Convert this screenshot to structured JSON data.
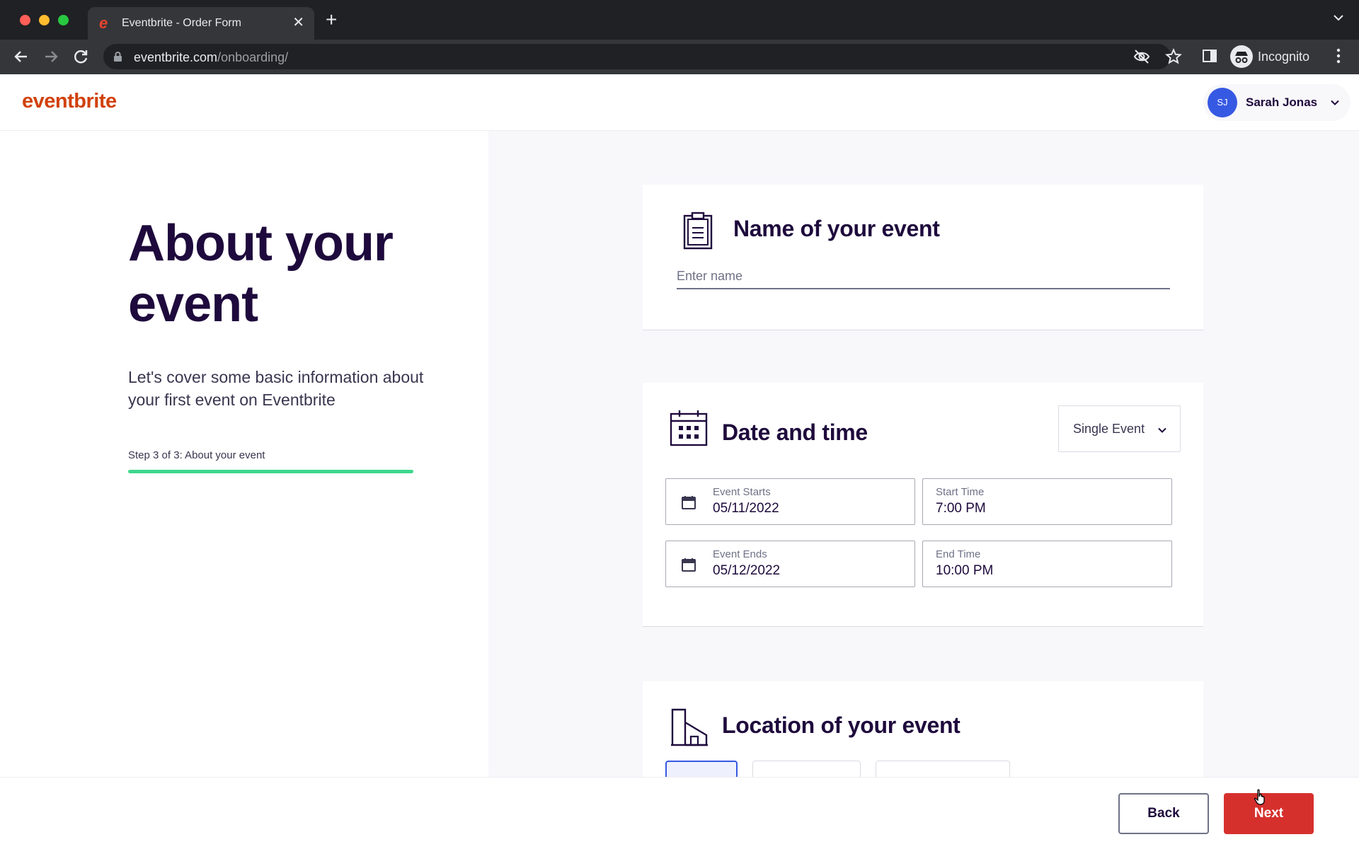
{
  "browser": {
    "tab_title": "Eventbrite - Order Form",
    "tab_favicon": "e",
    "url_host": "eventbrite.com",
    "url_path": "/onboarding/",
    "profile_label": "Incognito"
  },
  "header": {
    "logo": "eventbrite",
    "user_initials": "SJ",
    "user_name": "Sarah Jonas"
  },
  "intro": {
    "title": "About your event",
    "description": "Let's cover some basic information about your first event on Eventbrite",
    "step_label": "Step 3 of 3: About your event",
    "progress_fraction": 1.0
  },
  "name_section": {
    "title": "Name of your event",
    "placeholder": "Enter name",
    "value": ""
  },
  "date_section": {
    "title": "Date and time",
    "event_type": "Single Event",
    "event_starts_label": "Event Starts",
    "event_starts_value": "05/11/2022",
    "start_time_label": "Start Time",
    "start_time_value": "7:00 PM",
    "event_ends_label": "Event Ends",
    "event_ends_value": "05/12/2022",
    "end_time_label": "End Time",
    "end_time_value": "10:00 PM"
  },
  "location_section": {
    "title": "Location of your event"
  },
  "footer": {
    "back_label": "Back",
    "next_label": "Next"
  },
  "colors": {
    "brand": "#d1410c",
    "next_button": "#d6302d",
    "heading": "#1e0a3c",
    "progress": "#3ed88c",
    "avatar": "#3659e3"
  },
  "icons": [
    "back-arrow-icon",
    "forward-arrow-icon",
    "reload-icon",
    "lock-icon",
    "eye-off-icon",
    "star-icon",
    "sidebar-icon",
    "incognito-icon",
    "menu-dots-icon",
    "clipboard-icon",
    "calendar-icon",
    "building-icon",
    "chevron-down-icon",
    "hand-cursor-icon"
  ]
}
